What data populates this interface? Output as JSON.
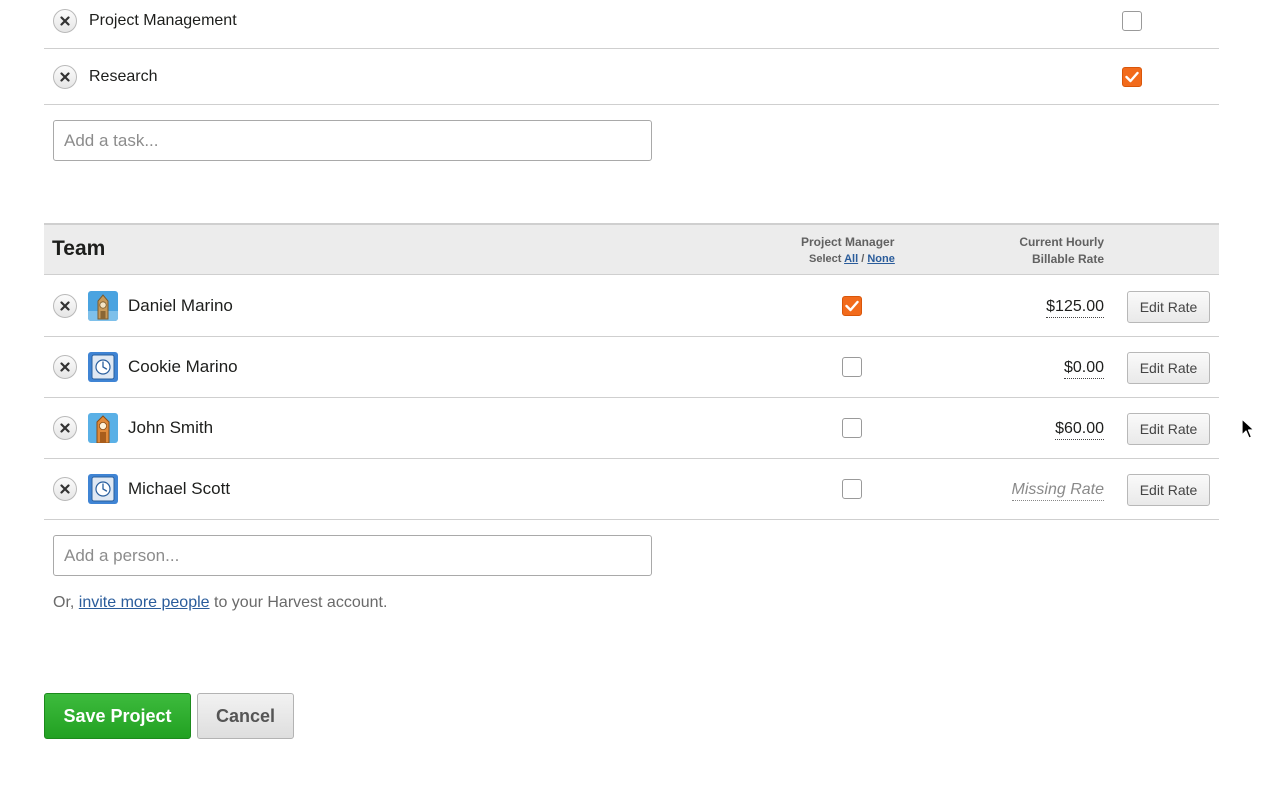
{
  "tasks": [
    {
      "name": "Project Management",
      "billable": false
    },
    {
      "name": "Research",
      "billable": true
    }
  ],
  "add_task": {
    "placeholder": "Add a task..."
  },
  "team": {
    "title": "Team",
    "pm_header": "Project Manager",
    "select_label": "Select",
    "select_all": "All",
    "select_sep": "/",
    "select_none": "None",
    "rate_header_line1": "Current Hourly",
    "rate_header_line2": "Billable Rate",
    "members": [
      {
        "name": "Daniel Marino",
        "is_manager": true,
        "rate": "$125.00",
        "edit_label": "Edit Rate",
        "avatar_icon": "clock-tower-avatar"
      },
      {
        "name": "Cookie Marino",
        "is_manager": false,
        "rate": "$0.00",
        "edit_label": "Edit Rate",
        "avatar_icon": "clock-avatar"
      },
      {
        "name": "John Smith",
        "is_manager": false,
        "rate": "$60.00",
        "edit_label": "Edit Rate",
        "avatar_icon": "clock-tower-avatar"
      },
      {
        "name": "Michael Scott",
        "is_manager": false,
        "rate": "Missing Rate",
        "rate_missing": true,
        "edit_label": "Edit Rate",
        "avatar_icon": "clock-avatar"
      }
    ]
  },
  "add_person": {
    "placeholder": "Add a person..."
  },
  "invite": {
    "prefix": "Or,",
    "link": "invite more people",
    "suffix": "to your Harvest account."
  },
  "actions": {
    "save": "Save Project",
    "cancel": "Cancel"
  },
  "colors": {
    "accent_orange": "#f26b1c",
    "save_green": "#2aa52a",
    "link_blue": "#2a5c9b"
  }
}
